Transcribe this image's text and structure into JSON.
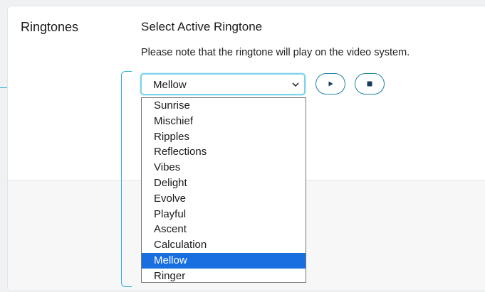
{
  "section": {
    "label": "Ringtones"
  },
  "panel": {
    "heading": "Select Active Ringtone",
    "note": "Please note that the ringtone will play on the video system."
  },
  "select": {
    "selected": "Mellow",
    "options": [
      "Sunrise",
      "Mischief",
      "Ripples",
      "Reflections",
      "Vibes",
      "Delight",
      "Evolve",
      "Playful",
      "Ascent",
      "Calculation",
      "Mellow",
      "Ringer"
    ],
    "selected_index": 10
  },
  "controls": {
    "play_icon": "play-icon",
    "stop_icon": "stop-icon"
  },
  "colors": {
    "accent": "#1d7fa6",
    "focus": "#7fd3ea",
    "connector": "#2ab3d6",
    "highlight": "#1a6fe0"
  }
}
